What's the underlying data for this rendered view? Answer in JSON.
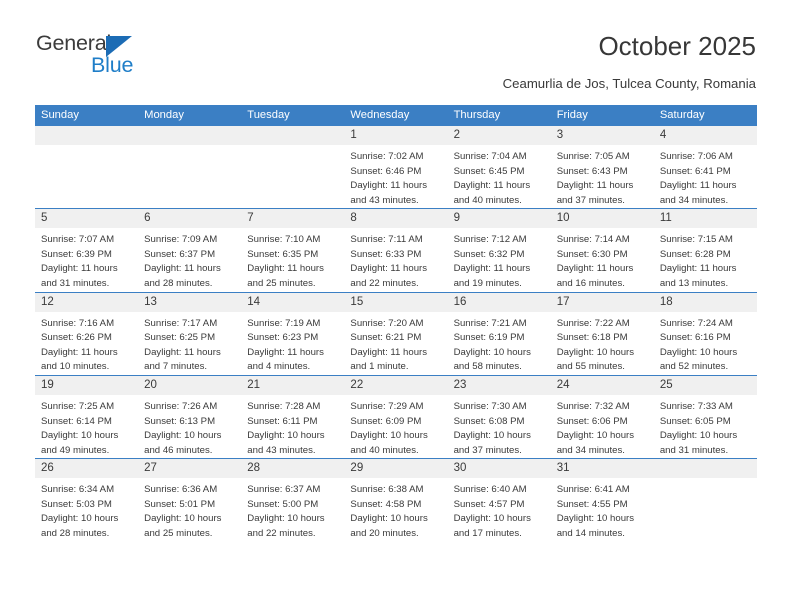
{
  "brand": {
    "name_part1": "General",
    "name_part2": "Blue",
    "triangle_color": "#1c6cb5",
    "blue_color": "#1f7ec8"
  },
  "header": {
    "title": "October 2025",
    "subtitle": "Ceamurlia de Jos, Tulcea County, Romania"
  },
  "theme": {
    "header_blue": "#3b7fc4",
    "daynum_gray": "#f0f0f0",
    "text_color": "#3a3a3a"
  },
  "calendar": {
    "weekday_headers": [
      "Sunday",
      "Monday",
      "Tuesday",
      "Wednesday",
      "Thursday",
      "Friday",
      "Saturday"
    ],
    "weeks": [
      [
        {
          "day": "",
          "sunrise": "",
          "sunset": "",
          "daylight1": "",
          "daylight2": ""
        },
        {
          "day": "",
          "sunrise": "",
          "sunset": "",
          "daylight1": "",
          "daylight2": ""
        },
        {
          "day": "",
          "sunrise": "",
          "sunset": "",
          "daylight1": "",
          "daylight2": ""
        },
        {
          "day": "1",
          "sunrise": "Sunrise: 7:02 AM",
          "sunset": "Sunset: 6:46 PM",
          "daylight1": "Daylight: 11 hours",
          "daylight2": "and 43 minutes."
        },
        {
          "day": "2",
          "sunrise": "Sunrise: 7:04 AM",
          "sunset": "Sunset: 6:45 PM",
          "daylight1": "Daylight: 11 hours",
          "daylight2": "and 40 minutes."
        },
        {
          "day": "3",
          "sunrise": "Sunrise: 7:05 AM",
          "sunset": "Sunset: 6:43 PM",
          "daylight1": "Daylight: 11 hours",
          "daylight2": "and 37 minutes."
        },
        {
          "day": "4",
          "sunrise": "Sunrise: 7:06 AM",
          "sunset": "Sunset: 6:41 PM",
          "daylight1": "Daylight: 11 hours",
          "daylight2": "and 34 minutes."
        }
      ],
      [
        {
          "day": "5",
          "sunrise": "Sunrise: 7:07 AM",
          "sunset": "Sunset: 6:39 PM",
          "daylight1": "Daylight: 11 hours",
          "daylight2": "and 31 minutes."
        },
        {
          "day": "6",
          "sunrise": "Sunrise: 7:09 AM",
          "sunset": "Sunset: 6:37 PM",
          "daylight1": "Daylight: 11 hours",
          "daylight2": "and 28 minutes."
        },
        {
          "day": "7",
          "sunrise": "Sunrise: 7:10 AM",
          "sunset": "Sunset: 6:35 PM",
          "daylight1": "Daylight: 11 hours",
          "daylight2": "and 25 minutes."
        },
        {
          "day": "8",
          "sunrise": "Sunrise: 7:11 AM",
          "sunset": "Sunset: 6:33 PM",
          "daylight1": "Daylight: 11 hours",
          "daylight2": "and 22 minutes."
        },
        {
          "day": "9",
          "sunrise": "Sunrise: 7:12 AM",
          "sunset": "Sunset: 6:32 PM",
          "daylight1": "Daylight: 11 hours",
          "daylight2": "and 19 minutes."
        },
        {
          "day": "10",
          "sunrise": "Sunrise: 7:14 AM",
          "sunset": "Sunset: 6:30 PM",
          "daylight1": "Daylight: 11 hours",
          "daylight2": "and 16 minutes."
        },
        {
          "day": "11",
          "sunrise": "Sunrise: 7:15 AM",
          "sunset": "Sunset: 6:28 PM",
          "daylight1": "Daylight: 11 hours",
          "daylight2": "and 13 minutes."
        }
      ],
      [
        {
          "day": "12",
          "sunrise": "Sunrise: 7:16 AM",
          "sunset": "Sunset: 6:26 PM",
          "daylight1": "Daylight: 11 hours",
          "daylight2": "and 10 minutes."
        },
        {
          "day": "13",
          "sunrise": "Sunrise: 7:17 AM",
          "sunset": "Sunset: 6:25 PM",
          "daylight1": "Daylight: 11 hours",
          "daylight2": "and 7 minutes."
        },
        {
          "day": "14",
          "sunrise": "Sunrise: 7:19 AM",
          "sunset": "Sunset: 6:23 PM",
          "daylight1": "Daylight: 11 hours",
          "daylight2": "and 4 minutes."
        },
        {
          "day": "15",
          "sunrise": "Sunrise: 7:20 AM",
          "sunset": "Sunset: 6:21 PM",
          "daylight1": "Daylight: 11 hours",
          "daylight2": "and 1 minute."
        },
        {
          "day": "16",
          "sunrise": "Sunrise: 7:21 AM",
          "sunset": "Sunset: 6:19 PM",
          "daylight1": "Daylight: 10 hours",
          "daylight2": "and 58 minutes."
        },
        {
          "day": "17",
          "sunrise": "Sunrise: 7:22 AM",
          "sunset": "Sunset: 6:18 PM",
          "daylight1": "Daylight: 10 hours",
          "daylight2": "and 55 minutes."
        },
        {
          "day": "18",
          "sunrise": "Sunrise: 7:24 AM",
          "sunset": "Sunset: 6:16 PM",
          "daylight1": "Daylight: 10 hours",
          "daylight2": "and 52 minutes."
        }
      ],
      [
        {
          "day": "19",
          "sunrise": "Sunrise: 7:25 AM",
          "sunset": "Sunset: 6:14 PM",
          "daylight1": "Daylight: 10 hours",
          "daylight2": "and 49 minutes."
        },
        {
          "day": "20",
          "sunrise": "Sunrise: 7:26 AM",
          "sunset": "Sunset: 6:13 PM",
          "daylight1": "Daylight: 10 hours",
          "daylight2": "and 46 minutes."
        },
        {
          "day": "21",
          "sunrise": "Sunrise: 7:28 AM",
          "sunset": "Sunset: 6:11 PM",
          "daylight1": "Daylight: 10 hours",
          "daylight2": "and 43 minutes."
        },
        {
          "day": "22",
          "sunrise": "Sunrise: 7:29 AM",
          "sunset": "Sunset: 6:09 PM",
          "daylight1": "Daylight: 10 hours",
          "daylight2": "and 40 minutes."
        },
        {
          "day": "23",
          "sunrise": "Sunrise: 7:30 AM",
          "sunset": "Sunset: 6:08 PM",
          "daylight1": "Daylight: 10 hours",
          "daylight2": "and 37 minutes."
        },
        {
          "day": "24",
          "sunrise": "Sunrise: 7:32 AM",
          "sunset": "Sunset: 6:06 PM",
          "daylight1": "Daylight: 10 hours",
          "daylight2": "and 34 minutes."
        },
        {
          "day": "25",
          "sunrise": "Sunrise: 7:33 AM",
          "sunset": "Sunset: 6:05 PM",
          "daylight1": "Daylight: 10 hours",
          "daylight2": "and 31 minutes."
        }
      ],
      [
        {
          "day": "26",
          "sunrise": "Sunrise: 6:34 AM",
          "sunset": "Sunset: 5:03 PM",
          "daylight1": "Daylight: 10 hours",
          "daylight2": "and 28 minutes."
        },
        {
          "day": "27",
          "sunrise": "Sunrise: 6:36 AM",
          "sunset": "Sunset: 5:01 PM",
          "daylight1": "Daylight: 10 hours",
          "daylight2": "and 25 minutes."
        },
        {
          "day": "28",
          "sunrise": "Sunrise: 6:37 AM",
          "sunset": "Sunset: 5:00 PM",
          "daylight1": "Daylight: 10 hours",
          "daylight2": "and 22 minutes."
        },
        {
          "day": "29",
          "sunrise": "Sunrise: 6:38 AM",
          "sunset": "Sunset: 4:58 PM",
          "daylight1": "Daylight: 10 hours",
          "daylight2": "and 20 minutes."
        },
        {
          "day": "30",
          "sunrise": "Sunrise: 6:40 AM",
          "sunset": "Sunset: 4:57 PM",
          "daylight1": "Daylight: 10 hours",
          "daylight2": "and 17 minutes."
        },
        {
          "day": "31",
          "sunrise": "Sunrise: 6:41 AM",
          "sunset": "Sunset: 4:55 PM",
          "daylight1": "Daylight: 10 hours",
          "daylight2": "and 14 minutes."
        },
        {
          "day": "",
          "sunrise": "",
          "sunset": "",
          "daylight1": "",
          "daylight2": ""
        }
      ]
    ]
  }
}
